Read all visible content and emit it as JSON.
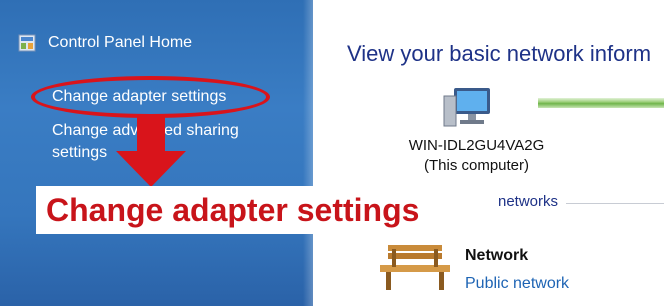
{
  "navigation": {
    "home_label": "Control Panel Home",
    "links": [
      {
        "label": "Change adapter settings"
      },
      {
        "label": "Change advanced sharing settings"
      }
    ]
  },
  "main": {
    "title": "View your basic network inform",
    "computer": {
      "name": "WIN-IDL2GU4VA2G",
      "subtitle": "(This computer)"
    },
    "section_header": "networks",
    "network": {
      "name": "Network",
      "type": "Public network"
    }
  },
  "callout": {
    "text": "Change adapter settings",
    "color": "#c8141a"
  },
  "colors": {
    "highlight": "#d9141b",
    "nav_background": "#3576bd",
    "link_blue": "#1e64b4"
  },
  "icons": [
    "control-panel-icon",
    "computer-icon",
    "bench-network-icon",
    "down-arrow-icon"
  ]
}
